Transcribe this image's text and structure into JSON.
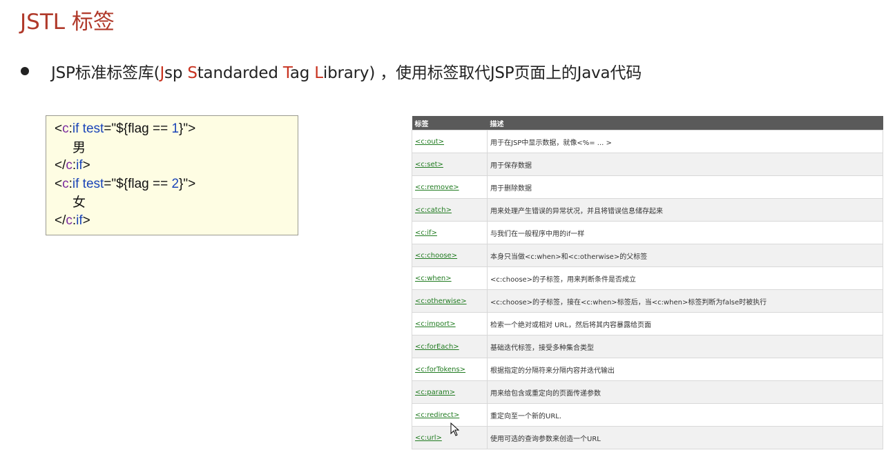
{
  "slide": {
    "title": "JSTL 标签",
    "bullet": {
      "p1": "JSP标准标签库(",
      "j": "J",
      "p2": "sp ",
      "s": "S",
      "p3": "tandarded ",
      "t": "T",
      "p4": "ag ",
      "l": "L",
      "p5": "ibrary) ，使用标签取代JSP页面上的Java代码"
    }
  },
  "code": {
    "lt": "<",
    "prefix": "c",
    "colon": ":",
    "tag_if": "if",
    "attr": " test",
    "eq_open": "=\"${",
    "expr": "flag == ",
    "val1": "1",
    "val2": "2",
    "close_brace": "}\">",
    "male": "男",
    "female": "女",
    "end_open": "</",
    "gt": ">"
  },
  "table": {
    "headers": [
      "标签",
      "描述"
    ],
    "rows": [
      {
        "tag": "<c:out>",
        "desc": "用于在JSP中显示数据，就像<%= ... >"
      },
      {
        "tag": "<c:set>",
        "desc": "用于保存数据"
      },
      {
        "tag": "<c:remove>",
        "desc": "用于删除数据"
      },
      {
        "tag": "<c:catch>",
        "desc": "用来处理产生错误的异常状况，并且将错误信息储存起来"
      },
      {
        "tag": "<c:if>",
        "desc": "与我们在一般程序中用的if一样"
      },
      {
        "tag": "<c:choose>",
        "desc": "本身只当做<c:when>和<c:otherwise>的父标签"
      },
      {
        "tag": "<c:when>",
        "desc": "<c:choose>的子标签，用来判断条件是否成立"
      },
      {
        "tag": "<c:otherwise>",
        "desc": "<c:choose>的子标签，接在<c:when>标签后，当<c:when>标签判断为false时被执行"
      },
      {
        "tag": "<c:import>",
        "desc": "检索一个绝对或相对 URL，然后将其内容暴露给页面"
      },
      {
        "tag": "<c:forEach>",
        "desc": "基础迭代标签，接受多种集合类型"
      },
      {
        "tag": "<c:forTokens>",
        "desc": "根据指定的分隔符来分隔内容并迭代输出"
      },
      {
        "tag": "<c:param>",
        "desc": "用来给包含或重定向的页面传递参数"
      },
      {
        "tag": "<c:redirect>",
        "desc": "重定向至一个新的URL."
      },
      {
        "tag": "<c:url>",
        "desc": "使用可选的查询参数来创造一个URL"
      }
    ]
  }
}
